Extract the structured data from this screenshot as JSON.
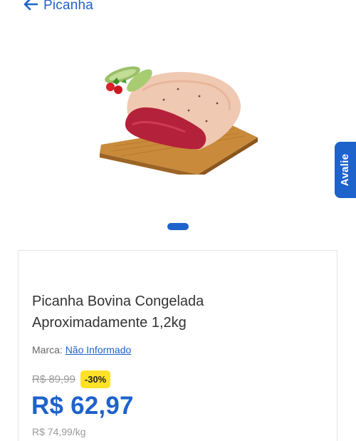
{
  "header": {
    "back_label": "Picanha"
  },
  "product": {
    "image_icon": "product-photo-picanha",
    "carousel": {
      "current": 1,
      "total": 1
    },
    "title": "Picanha Bovina Congelada Aproximadamente 1,2kg",
    "brand_label": "Marca:",
    "brand_value": "Não Informado",
    "old_price": "R$ 89,99",
    "discount": "-30%",
    "price": "R$ 62,97",
    "unit_price": "R$ 74,99/kg"
  },
  "side_tab": {
    "label": "Avalie"
  },
  "colors": {
    "accent": "#1e62cc",
    "discount_badge": "#ffe12a"
  }
}
